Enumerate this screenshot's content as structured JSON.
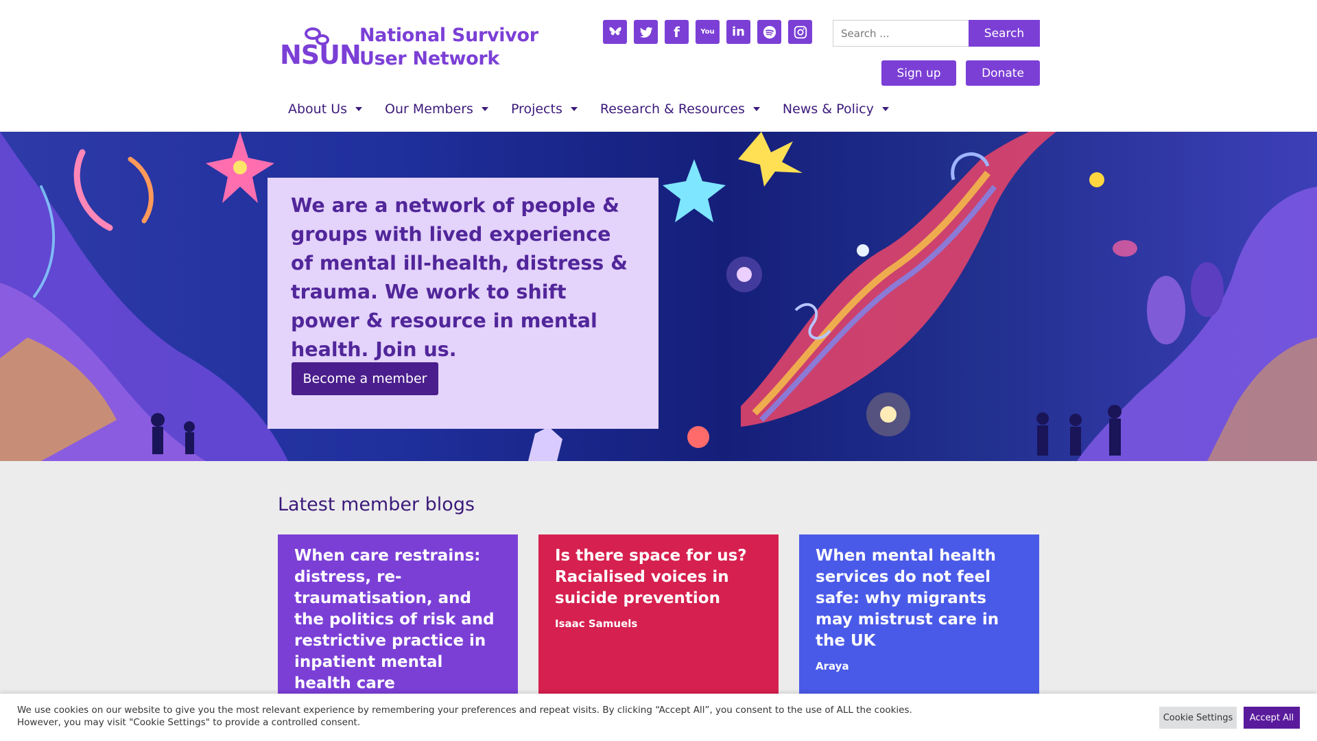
{
  "brand": {
    "logo_letters": "NSUN",
    "name_line1": "National Survivor",
    "name_line2": "User Network"
  },
  "socials": [
    {
      "icon": "bluesky-icon"
    },
    {
      "icon": "twitter-icon"
    },
    {
      "icon": "facebook-icon",
      "glyph": "f"
    },
    {
      "icon": "youtube-icon",
      "glyph": "You"
    },
    {
      "icon": "linkedin-icon",
      "glyph": "in"
    },
    {
      "icon": "spotify-icon"
    },
    {
      "icon": "instagram-icon"
    }
  ],
  "search": {
    "placeholder": "Search ...",
    "button_label": "Search"
  },
  "header_buttons": {
    "signup_label": "Sign up",
    "donate_label": "Donate"
  },
  "nav": [
    {
      "label": "About Us"
    },
    {
      "label": "Our Members"
    },
    {
      "label": "Projects"
    },
    {
      "label": "Research & Resources"
    },
    {
      "label": "News & Policy"
    }
  ],
  "hero": {
    "heading": "We are a network of people & groups with lived experience of mental ill-health, distress & trauma. We work to shift power & resource in mental health. Join us.",
    "cta_label": "Become a member"
  },
  "blogs": {
    "heading": "Latest member blogs",
    "cards": [
      {
        "title": "When care restrains: distress, re-traumatisation, and the politics of risk and restrictive practice in inpatient mental health care",
        "author": ""
      },
      {
        "title": "Is there space for us? Racialised voices in suicide prevention",
        "author": "Isaac Samuels"
      },
      {
        "title": "When mental health services do not feel safe: why migrants may mistrust care in the UK",
        "author": "Araya"
      }
    ]
  },
  "cookie": {
    "text": "We use cookies on our website to give you the most relevant experience by remembering your preferences and repeat visits. By clicking “Accept All”, you consent to the use of ALL the cookies. However, you may visit \"Cookie Settings\" to provide a controlled consent.",
    "settings_label": "Cookie Settings",
    "accept_label": "Accept All"
  },
  "colors": {
    "brand_purple": "#7b3fd6",
    "dark_purple": "#3b1a7a",
    "hero_card": "#e4d3fa",
    "card_red": "#d6204f",
    "card_blue": "#4a5ae8"
  }
}
